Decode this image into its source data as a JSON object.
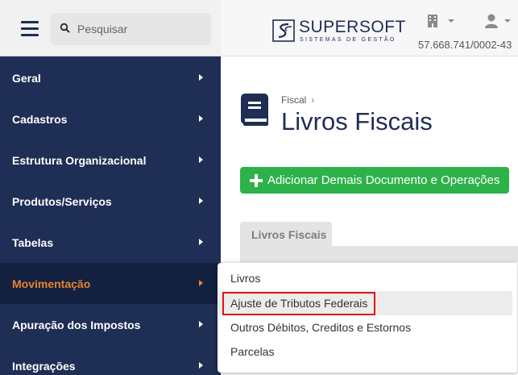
{
  "search": {
    "placeholder": "Pesquisar"
  },
  "sidebar": {
    "items": [
      {
        "label": "Geral"
      },
      {
        "label": "Cadastros"
      },
      {
        "label": "Estrutura Organizacional"
      },
      {
        "label": "Produtos/Serviços"
      },
      {
        "label": "Tabelas"
      },
      {
        "label": "Movimentação",
        "active": true
      },
      {
        "label": "Apuração dos Impostos"
      },
      {
        "label": "Integrações"
      }
    ]
  },
  "header": {
    "brand": "SUPERSOFT",
    "brand_sub": "SISTEMAS DE GESTÃO",
    "cnpj": "57.668.741/0002-43"
  },
  "main": {
    "breadcrumb": "Fiscal",
    "breadcrumb_sep": "›",
    "title": "Livros Fiscais",
    "add_button": "Adicionar Demais Documento e Operações",
    "tab": "Livros Fiscais"
  },
  "submenu": {
    "items": [
      {
        "label": "Livros"
      },
      {
        "label": "Ajuste de Tributos Federais",
        "highlighted": true
      },
      {
        "label": "Outros Débitos, Creditos e Estornos"
      },
      {
        "label": "Parcelas"
      }
    ]
  },
  "colors": {
    "sidebar": "#1f2e55",
    "active_text": "#e8842a",
    "accent_green": "#2db24a",
    "highlight_border": "#e0141a"
  }
}
